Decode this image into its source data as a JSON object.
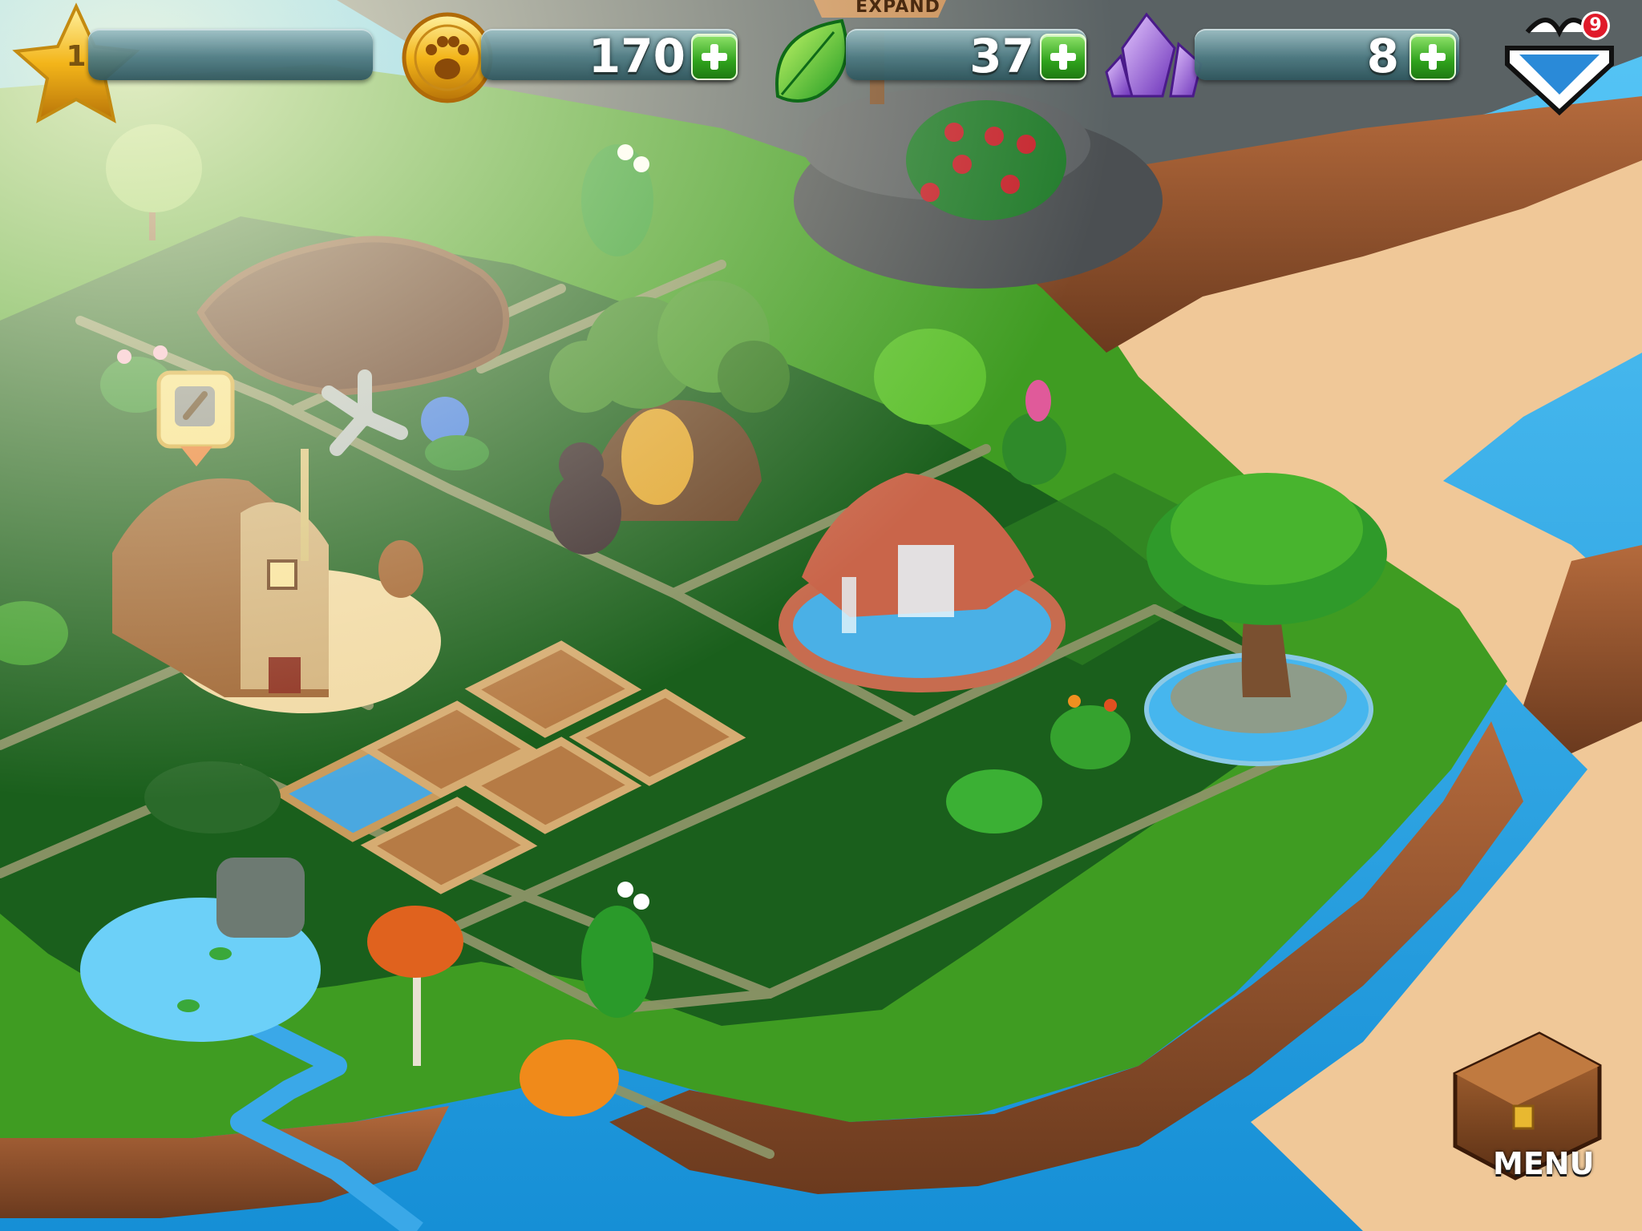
{
  "hud": {
    "level": {
      "value": "1",
      "icon": "star-icon"
    },
    "coins": {
      "value": "170",
      "icon": "paw-coin-icon"
    },
    "leaves": {
      "value": "37",
      "icon": "leaf-icon"
    },
    "gems": {
      "value": "8",
      "icon": "crystal-icon"
    },
    "gift": {
      "badge": "9",
      "icon": "gift-icon"
    }
  },
  "world": {
    "expand_sign": "EXPAND",
    "menu_label": "MENU"
  },
  "colors": {
    "grass_light": "#3f9c22",
    "grass_dark": "#1a5f1c",
    "path": "#8c9467",
    "water": "#28a8ec",
    "cliff": "#9b5a33",
    "sand": "#f0c898"
  }
}
